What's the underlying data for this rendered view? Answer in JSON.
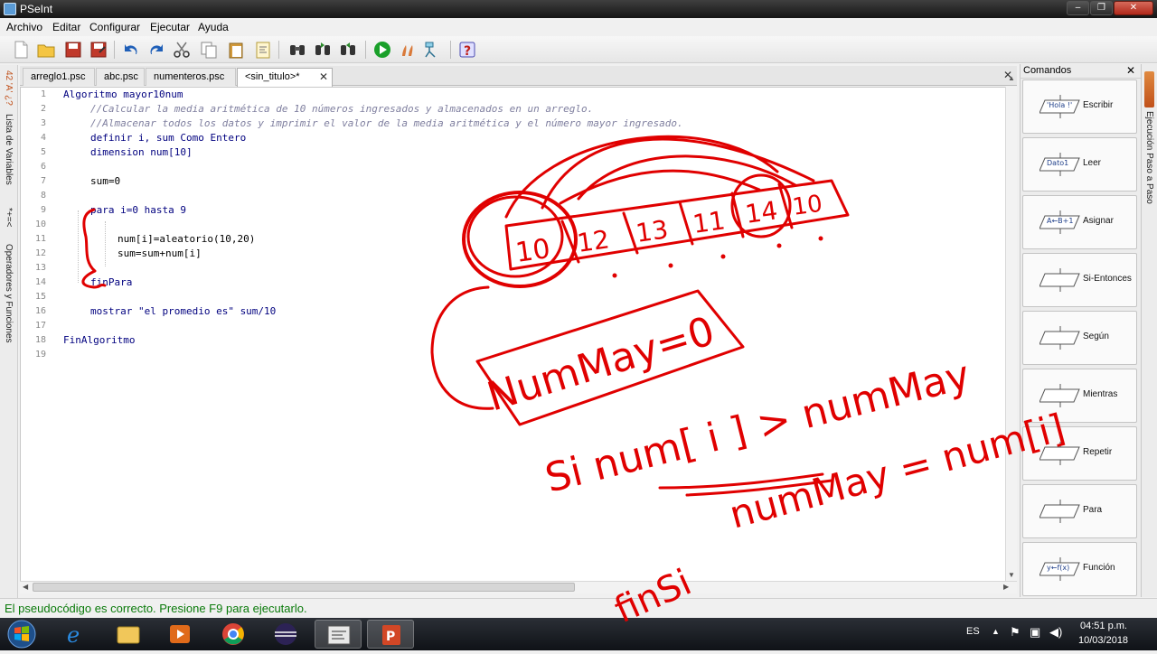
{
  "window": {
    "title": "PSeInt"
  },
  "menu": [
    "Archivo",
    "Editar",
    "Configurar",
    "Ejecutar",
    "Ayuda"
  ],
  "tabs": [
    {
      "label": "arreglo1.psc",
      "active": false
    },
    {
      "label": "abc.psc",
      "active": false
    },
    {
      "label": "numenteros.psc",
      "active": false
    },
    {
      "label": "<sin_titulo>*",
      "active": true
    }
  ],
  "left_panel": {
    "variables_label": "Lista de Variables",
    "operators_label": "Operadores y Funciones"
  },
  "right_panel": {
    "label": "Ejecución Paso a Paso"
  },
  "editor": {
    "lines": [
      {
        "n": "1",
        "text": "Algoritmo mayor10num"
      },
      {
        "n": "2",
        "text": "//Calcular la media aritmética de 10 números ingresados y almacenados en un arreglo."
      },
      {
        "n": "3",
        "text": "//Almacenar todos los datos y imprimir el valor de la media aritmética y el número mayor ingresado."
      },
      {
        "n": "4",
        "text": "definir i, sum Como Entero"
      },
      {
        "n": "5",
        "text": "dimension num[10]"
      },
      {
        "n": "6",
        "text": ""
      },
      {
        "n": "7",
        "text": "sum=0"
      },
      {
        "n": "8",
        "text": ""
      },
      {
        "n": "9",
        "text": "para i=0 hasta 9"
      },
      {
        "n": "10",
        "text": ""
      },
      {
        "n": "11",
        "text": "num[i]=aleatorio(10,20)"
      },
      {
        "n": "12",
        "text": "sum=sum+num[i]"
      },
      {
        "n": "13",
        "text": ""
      },
      {
        "n": "14",
        "text": "finPara"
      },
      {
        "n": "15",
        "text": ""
      },
      {
        "n": "16",
        "text": "mostrar \"el promedio es\" sum/10"
      },
      {
        "n": "17",
        "text": ""
      },
      {
        "n": "18",
        "text": "FinAlgoritmo"
      },
      {
        "n": "19",
        "text": ""
      }
    ]
  },
  "commands": {
    "header": "Comandos",
    "items": [
      {
        "label": "Escribir",
        "shape_text": "'Hola !'"
      },
      {
        "label": "Leer",
        "shape_text": "Dato1"
      },
      {
        "label": "Asignar",
        "shape_text": "A←B+1"
      },
      {
        "label": "Si-Entonces",
        "shape_text": ""
      },
      {
        "label": "Según",
        "shape_text": ""
      },
      {
        "label": "Mientras",
        "shape_text": ""
      },
      {
        "label": "Repetir",
        "shape_text": ""
      },
      {
        "label": "Para",
        "shape_text": ""
      },
      {
        "label": "Función",
        "shape_text": "y←f(x)"
      }
    ]
  },
  "status": "El pseudocódigo es correcto. Presione F9 para ejecutarlo.",
  "taskbar": {
    "language": "ES",
    "time": "04:51 p.m.",
    "date": "10/03/2018"
  },
  "annotations": {
    "array_values": [
      "10",
      "12",
      "13",
      "11",
      "14",
      "10"
    ],
    "box_text": "NumMay=0",
    "if_text": "Si  num[ i ] > numMay",
    "assign_text": "numMay = num[i]",
    "end_text": "finSi",
    "ink_color": "#e00000"
  }
}
